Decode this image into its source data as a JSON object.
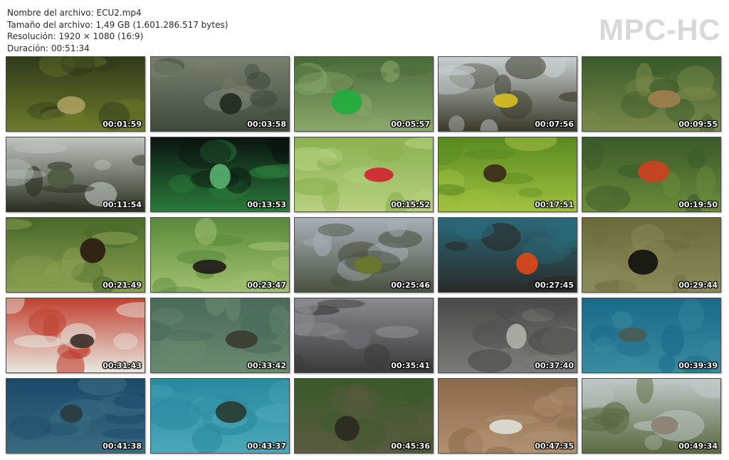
{
  "file_info": {
    "name_line": "Nombre del archivo: ECU2.mp4",
    "size_line": "Tamaño del archivo: 1,49 GB (1.601.286.517 bytes)",
    "resolution_line": "Resolución: 1920 × 1080 (16:9)",
    "duration_line": "Duración: 00:51:34"
  },
  "logo": "MPC-HC",
  "thumbnails": [
    {
      "time": "00:01:59",
      "scene": "jungle-canopy-bromeliads",
      "colors": [
        "#2f3a1a",
        "#6d7a2a",
        "#a8a060"
      ]
    },
    {
      "time": "00:03:58",
      "scene": "misty-cloud-forest",
      "colors": [
        "#7a8070",
        "#3e4a3a",
        "#1f2a1e"
      ]
    },
    {
      "time": "00:05:57",
      "scene": "green-hummingbird-on-moss",
      "colors": [
        "#4a6a3a",
        "#8aa86a",
        "#1fae3f"
      ]
    },
    {
      "time": "00:07:56",
      "scene": "toucans-on-branch",
      "colors": [
        "#c8cfd0",
        "#3a3a2a",
        "#d8c020"
      ]
    },
    {
      "time": "00:09:55",
      "scene": "agouti-on-forest-floor",
      "colors": [
        "#3a5a2a",
        "#7a8a4a",
        "#a08050"
      ]
    },
    {
      "time": "00:11:54",
      "scene": "monkey-in-trees-silhouette",
      "colors": [
        "#c0c6c0",
        "#2a3020",
        "#505a40"
      ]
    },
    {
      "time": "00:13:53",
      "scene": "glass-frog-on-leaf",
      "colors": [
        "#0a1410",
        "#2a7a3a",
        "#5ab070"
      ]
    },
    {
      "time": "00:15:52",
      "scene": "hummingbird-red-flowers",
      "colors": [
        "#8ab050",
        "#b8d080",
        "#d02030"
      ]
    },
    {
      "time": "00:17:51",
      "scene": "butterfly-emerging",
      "colors": [
        "#5a8a20",
        "#a0c040",
        "#3a2818"
      ]
    },
    {
      "time": "00:19:50",
      "scene": "red-flowers-bird",
      "colors": [
        "#3a5a2a",
        "#6a8a3a",
        "#d04020"
      ]
    },
    {
      "time": "00:21:49",
      "scene": "howler-monkey-branch",
      "colors": [
        "#4a6a2a",
        "#8aa050",
        "#2a1a10"
      ]
    },
    {
      "time": "00:23:47",
      "scene": "black-monkey-branch",
      "colors": [
        "#5a8a3a",
        "#a0c070",
        "#201818"
      ]
    },
    {
      "time": "00:25:46",
      "scene": "volcanic-landscape-sky",
      "colors": [
        "#a8b0b8",
        "#4a5040",
        "#6a7a2a"
      ]
    },
    {
      "time": "00:27:45",
      "scene": "red-crab-on-rock",
      "colors": [
        "#2a6a7a",
        "#2a2a28",
        "#e04818"
      ]
    },
    {
      "time": "00:29:44",
      "scene": "frigatebird-red-throat",
      "colors": [
        "#6a6a3a",
        "#8a8a5a",
        "#101010"
      ]
    },
    {
      "time": "00:31:43",
      "scene": "waved-albatross-pair",
      "colors": [
        "#c04030",
        "#e8e8e0",
        "#3a3028"
      ]
    },
    {
      "time": "00:33:42",
      "scene": "underwater-rocks-shallow",
      "colors": [
        "#4a6a5a",
        "#6a8a70",
        "#3a3a30"
      ]
    },
    {
      "time": "00:35:41",
      "scene": "marine-iguanas-rocks",
      "colors": [
        "#8a8a90",
        "#3a3a3a",
        "#6a6a70"
      ]
    },
    {
      "time": "00:37:40",
      "scene": "sea-lion-closeup",
      "colors": [
        "#4a4a4a",
        "#7a7a78",
        "#b0b0a8"
      ]
    },
    {
      "time": "00:39:39",
      "scene": "sea-lion-underwater",
      "colors": [
        "#1a6a8a",
        "#3a8aa0",
        "#4a5a50"
      ]
    },
    {
      "time": "00:41:38",
      "scene": "underwater-reef",
      "colors": [
        "#1a4a6a",
        "#3a6a80",
        "#2a3a40"
      ]
    },
    {
      "time": "00:43:37",
      "scene": "sea-turtle-swimming",
      "colors": [
        "#2a8aa0",
        "#4aa8b8",
        "#2a3a30"
      ]
    },
    {
      "time": "00:45:36",
      "scene": "giant-tortoises",
      "colors": [
        "#3a5a2a",
        "#5a5a40",
        "#2a2820"
      ]
    },
    {
      "time": "00:47:35",
      "scene": "boobies-on-ground",
      "colors": [
        "#8a6a4a",
        "#b09070",
        "#e0e0d8"
      ]
    },
    {
      "time": "00:49:34",
      "scene": "dry-forest-birds",
      "colors": [
        "#c0c8c8",
        "#5a6a40",
        "#8a8070"
      ]
    }
  ]
}
